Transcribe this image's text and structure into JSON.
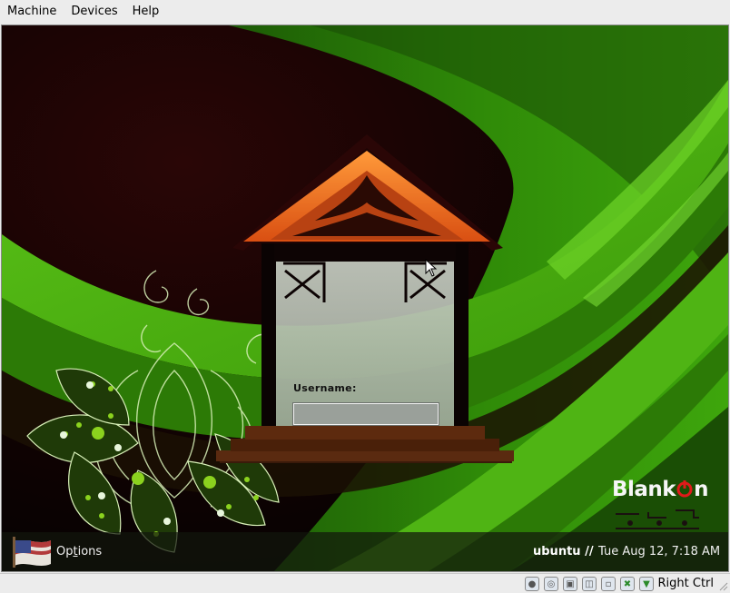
{
  "menubar": {
    "items": [
      {
        "label": "Machine"
      },
      {
        "label": "Devices"
      },
      {
        "label": "Help"
      }
    ]
  },
  "login": {
    "username_label": "Username:",
    "username_value": ""
  },
  "panel": {
    "options_label_pre": "Op",
    "options_label_mnemonic": "t",
    "options_label_post": "ions",
    "hostname": "ubuntu //",
    "datetime": "Tue Aug 12,  7:18 AM"
  },
  "branding": {
    "logo_text": "BlankOn",
    "logo_text_visible_prefix": "Blank",
    "logo_text_visible_suffix": "n"
  },
  "statusbar": {
    "icons": [
      "hard-disk-icon",
      "optical-disk-icon",
      "floppy-icon",
      "network-icon",
      "shared-folder-icon",
      "usb-icon",
      "mouse-integration-icon"
    ],
    "host_key_label": "Right Ctrl"
  },
  "colors": {
    "wallpaper_green": "#3f9a0a",
    "wallpaper_dark": "#0d0202",
    "roof_orange": "#e0601a",
    "accent_green": "#8bd21e"
  }
}
